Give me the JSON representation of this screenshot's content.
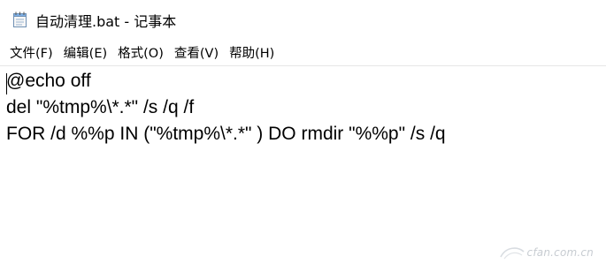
{
  "window": {
    "title": "自动清理.bat - 记事本",
    "icon": "notepad-icon"
  },
  "menu": {
    "items": [
      {
        "label": "文件(F)"
      },
      {
        "label": "编辑(E)"
      },
      {
        "label": "格式(O)"
      },
      {
        "label": "查看(V)"
      },
      {
        "label": "帮助(H)"
      }
    ]
  },
  "editor": {
    "lines": [
      "@echo off",
      "del \"%tmp%\\*.*\" /s /q /f",
      "FOR /d %%p IN (\"%tmp%\\*.*\" ) DO rmdir \"%%p\" /s /q"
    ]
  },
  "watermark": {
    "text": "cfan.com.cn",
    "icon": "cfan-logo-icon"
  },
  "colors": {
    "text": "#000000",
    "background": "#ffffff",
    "watermark": "#9aa3ad"
  }
}
